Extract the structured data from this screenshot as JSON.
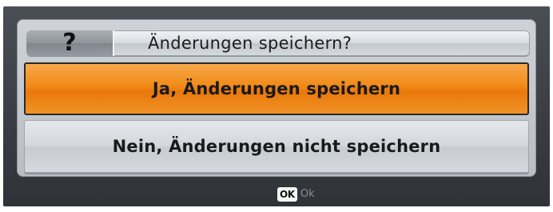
{
  "dialog": {
    "icon": "question-mark-icon",
    "icon_glyph": "?",
    "title": "Änderungen speichern?"
  },
  "options": [
    {
      "label": "Ja, Änderungen speichern",
      "selected": true
    },
    {
      "label": "Nein, Änderungen nicht speichern",
      "selected": false
    }
  ],
  "footer": {
    "key_badge": "OK",
    "key_label": "Ok"
  },
  "colors": {
    "accent_selected": "#f08a17",
    "frame": "#3a3e44",
    "panel": "#c7ccd1"
  }
}
